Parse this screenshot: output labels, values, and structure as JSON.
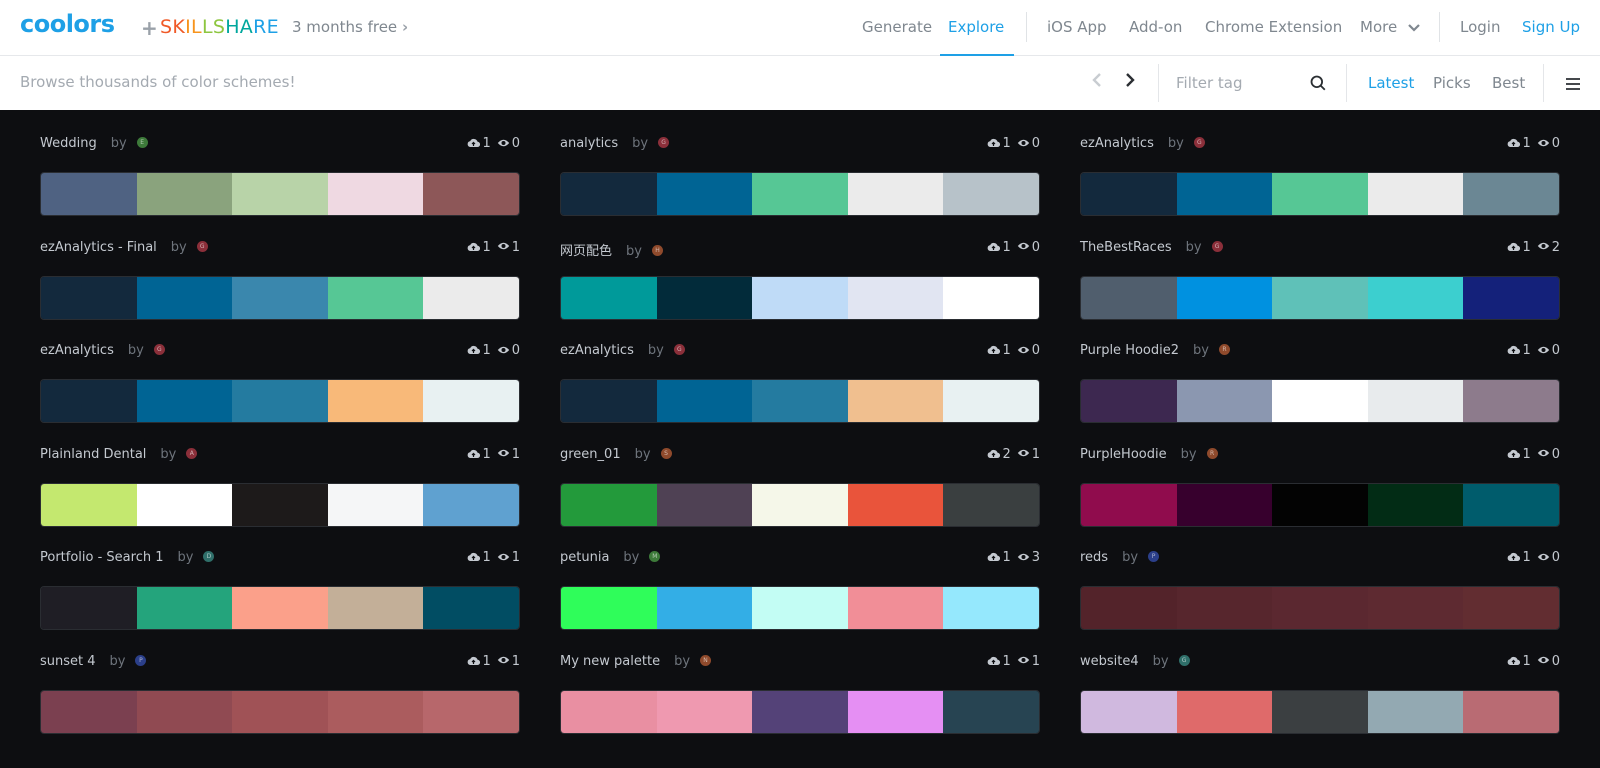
{
  "header": {
    "logo": "coolors",
    "plus": "+",
    "partner": [
      "S",
      "K",
      "I",
      "L",
      "L",
      "S",
      "H",
      "A",
      "R",
      "E"
    ],
    "partner_colors": [
      "#f05a28",
      "#f05a28",
      "#f7941d",
      "#f7941d",
      "#8dc63f",
      "#8dc63f",
      "#00a79d",
      "#00a79d",
      "#1ea0e6",
      "#1ea0e6"
    ],
    "promo": "3 months free",
    "nav": {
      "generate": "Generate",
      "explore": "Explore",
      "ios": "iOS App",
      "addon": "Add-on",
      "chrome": "Chrome Extension",
      "more": "More",
      "login": "Login",
      "signup": "Sign Up"
    }
  },
  "subbar": {
    "browse": "Browse thousands of color schemes!",
    "filter_placeholder": "Filter tag",
    "sort": {
      "latest": "Latest",
      "picks": "Picks",
      "best": "Best"
    }
  },
  "palettes": [
    {
      "title": "Wedding",
      "by": "by",
      "avatar": "#3d7a3a",
      "avatar_letter": "E",
      "likes": "1",
      "views": "0",
      "colors": [
        "#4f6282",
        "#8aa37d",
        "#b8d3a8",
        "#efd9e2",
        "#8d5758"
      ]
    },
    {
      "title": "analytics",
      "by": "by",
      "avatar": "#8b2f3a",
      "avatar_letter": "G",
      "likes": "1",
      "views": "0",
      "colors": [
        "#13293d",
        "#006494",
        "#56c795",
        "#ebebeb",
        "#b7c2c9"
      ]
    },
    {
      "title": "ezAnalytics",
      "by": "by",
      "avatar": "#8b2f3a",
      "avatar_letter": "G",
      "likes": "1",
      "views": "0",
      "colors": [
        "#13293d",
        "#006494",
        "#56c795",
        "#ebebeb",
        "#6b8794"
      ]
    },
    {
      "title": "ezAnalytics - Final",
      "by": "by",
      "avatar": "#8b2f3a",
      "avatar_letter": "G",
      "likes": "1",
      "views": "1",
      "colors": [
        "#13293d",
        "#006494",
        "#3a87ad",
        "#56c795",
        "#ebebeb"
      ]
    },
    {
      "title": "网页配色",
      "by": "by",
      "avatar": "#8f4a2c",
      "avatar_letter": "H",
      "likes": "1",
      "views": "0",
      "colors": [
        "#009a9a",
        "#022b3a",
        "#bfdbf7",
        "#e1e5f2",
        "#ffffff"
      ]
    },
    {
      "title": "TheBestRaces",
      "by": "by",
      "avatar": "#8b2f3a",
      "avatar_letter": "G",
      "likes": "1",
      "views": "2",
      "colors": [
        "#505e6d",
        "#0091e0",
        "#5fc1b8",
        "#3ccfcf",
        "#14217a"
      ]
    },
    {
      "title": "ezAnalytics",
      "by": "by",
      "avatar": "#8b2f3a",
      "avatar_letter": "G",
      "likes": "1",
      "views": "0",
      "colors": [
        "#13293d",
        "#006494",
        "#247ba0",
        "#f8b979",
        "#e8f1f2"
      ]
    },
    {
      "title": "ezAnalytics",
      "by": "by",
      "avatar": "#8b2f3a",
      "avatar_letter": "G",
      "likes": "1",
      "views": "0",
      "colors": [
        "#13293d",
        "#006494",
        "#247ba0",
        "#f0bf8f",
        "#e8f1f2"
      ]
    },
    {
      "title": "Purple Hoodie2",
      "by": "by",
      "avatar": "#8f4a2c",
      "avatar_letter": "R",
      "likes": "1",
      "views": "0",
      "colors": [
        "#3d2850",
        "#8b97b0",
        "#ffffff",
        "#e8ebed",
        "#8d7b8c"
      ]
    },
    {
      "title": "Plainland Dental",
      "by": "by",
      "avatar": "#8b2f3a",
      "avatar_letter": "A",
      "likes": "1",
      "views": "1",
      "colors": [
        "#c4e86f",
        "#ffffff",
        "#1d1a1a",
        "#f5f6f7",
        "#5fa1d0"
      ]
    },
    {
      "title": "green_01",
      "by": "by",
      "avatar": "#8f4a2c",
      "avatar_letter": "S",
      "likes": "2",
      "views": "1",
      "colors": [
        "#239a3b",
        "#4f4154",
        "#f5f7e9",
        "#e9543b",
        "#3a3f40"
      ]
    },
    {
      "title": "PurpleHoodie",
      "by": "by",
      "avatar": "#8f4a2c",
      "avatar_letter": "R",
      "likes": "1",
      "views": "0",
      "colors": [
        "#900c4d",
        "#37002d",
        "#030303",
        "#022c15",
        "#005c6c"
      ]
    },
    {
      "title": "Portfolio - Search 1",
      "by": "by",
      "avatar": "#2f6f6a",
      "avatar_letter": "D",
      "likes": "1",
      "views": "1",
      "colors": [
        "#1f1e25",
        "#24a47c",
        "#fba08a",
        "#c3af98",
        "#014d63"
      ]
    },
    {
      "title": "petunia",
      "by": "by",
      "avatar": "#3d7a3a",
      "avatar_letter": "M",
      "likes": "1",
      "views": "3",
      "colors": [
        "#2ffd5a",
        "#33aee6",
        "#c3fdf4",
        "#f18e97",
        "#95e8fd"
      ]
    },
    {
      "title": "reds",
      "by": "by",
      "avatar": "#2b3f8a",
      "avatar_letter": "P",
      "likes": "1",
      "views": "0",
      "colors": [
        "#53232a",
        "#57262d",
        "#5b2830",
        "#5e2a31",
        "#622d31"
      ]
    },
    {
      "title": "sunset 4",
      "by": "by",
      "avatar": "#2b3f8a",
      "avatar_letter": "P",
      "likes": "1",
      "views": "1",
      "colors": [
        "#7b4050",
        "#904a52",
        "#a05256",
        "#ab5c5e",
        "#b7676b"
      ]
    },
    {
      "title": "My new palette",
      "by": "by",
      "avatar": "#8f4a2c",
      "avatar_letter": "N",
      "likes": "1",
      "views": "1",
      "colors": [
        "#e98fa2",
        "#ef99b0",
        "#544278",
        "#e58ff3",
        "#274452"
      ]
    },
    {
      "title": "website4",
      "by": "by",
      "avatar": "#2f6f6a",
      "avatar_letter": "G",
      "likes": "1",
      "views": "0",
      "colors": [
        "#d0b9df",
        "#df6a6a",
        "#3b3f41",
        "#93a9b2",
        "#b96b73"
      ]
    }
  ]
}
